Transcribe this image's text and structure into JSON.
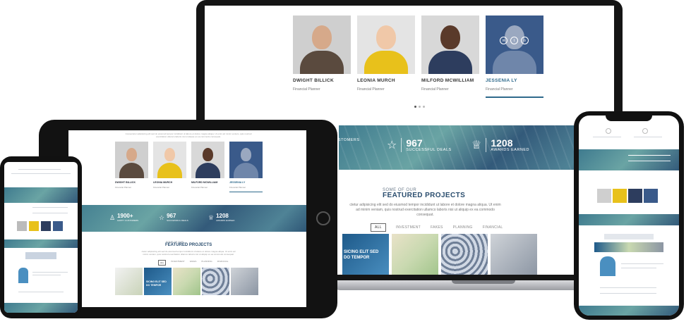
{
  "team": [
    {
      "name": "DWIGHT BILLICK",
      "role": "Financial Planner"
    },
    {
      "name": "LEONIA MURCH",
      "role": "Financial Planner"
    },
    {
      "name": "MILFORD MCWILLIAM",
      "role": "Financial Planner"
    },
    {
      "name": "JESSENIA LY",
      "role": "Financial Planner"
    }
  ],
  "socials": [
    "in",
    "t",
    "o"
  ],
  "stats": [
    {
      "icon": "user-icon",
      "value": "1900+",
      "label": "HAPPY CUSTOMERS",
      "label_partial": "CUSTOMERS"
    },
    {
      "icon": "star-icon",
      "value": "967",
      "label": "SUCCESSFUL DEALS"
    },
    {
      "icon": "trophy-icon",
      "value": "1208",
      "label": "AWARDS EARNED"
    }
  ],
  "projects_section": {
    "kicker": "SOME OF OUR",
    "title": "FEATURED PROJECTS",
    "text": "ctetur adipisicing elit sed do eiusmod tempor incididunt ut labore et dolore magna aliqua. Ut enim ad minim veniam, quis nostrud exercitation ullamco laboris nisi ut aliquip ex ea commodo consequat.",
    "filters": [
      "ALL",
      "INVESTMENT",
      "FAKES",
      "PLANNING",
      "FINANCIAL"
    ],
    "active_filter": "ALL",
    "project_caption": "SICING ELIT SED\nDO TEMPOR"
  },
  "tablet": {
    "intro": "Consectetur adipisicing elit sed do eiusmod tempor incididunt ut labore et dolore magna aliqua. Ut enim ad minim veniam, quis nostrud exercitation ullamco laboris nisi ut aliquip ex ea commodo consequat.",
    "project_caption": "SICING ELIT SED\nDO TEMPOR"
  }
}
